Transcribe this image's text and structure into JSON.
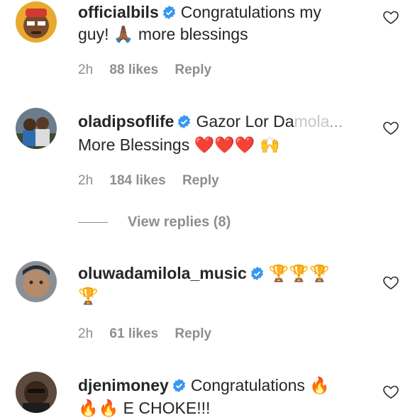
{
  "comments": [
    {
      "username": "officialbils",
      "text_1": "Congratulations my",
      "text_2": "guy!",
      "emoji_pray": "🙏🏾",
      "text_3": "more blessings",
      "time": "2h",
      "likes": "88 likes",
      "reply": "Reply"
    },
    {
      "username": "oladipsoflife",
      "text_1": "Gazor Lor Da",
      "text_faded": "mola",
      "ellipsis": "...",
      "text_2": "More Blessings",
      "emoji_hearts": "❤️❤️❤️",
      "emoji_hands": "🙌",
      "time": "2h",
      "likes": "184 likes",
      "reply": "Reply",
      "view_replies": "View replies (8)"
    },
    {
      "username": "oluwadamilola_music",
      "emoji_line1": "🏆🏆🏆",
      "emoji_line2": "🏆",
      "time": "2h",
      "likes": "61 likes",
      "reply": "Reply"
    },
    {
      "username": "djenimoney",
      "text_1": "Congratulations",
      "emoji_fire_1": "🔥",
      "emoji_fire_2": "🔥🔥",
      "text_2": "E CHOKE!!!"
    }
  ],
  "colors": {
    "verified": "#3897f0",
    "muted": "#8e8e8e",
    "text": "#262626"
  },
  "icons": [
    "verified-badge-icon",
    "heart-outline-icon"
  ]
}
